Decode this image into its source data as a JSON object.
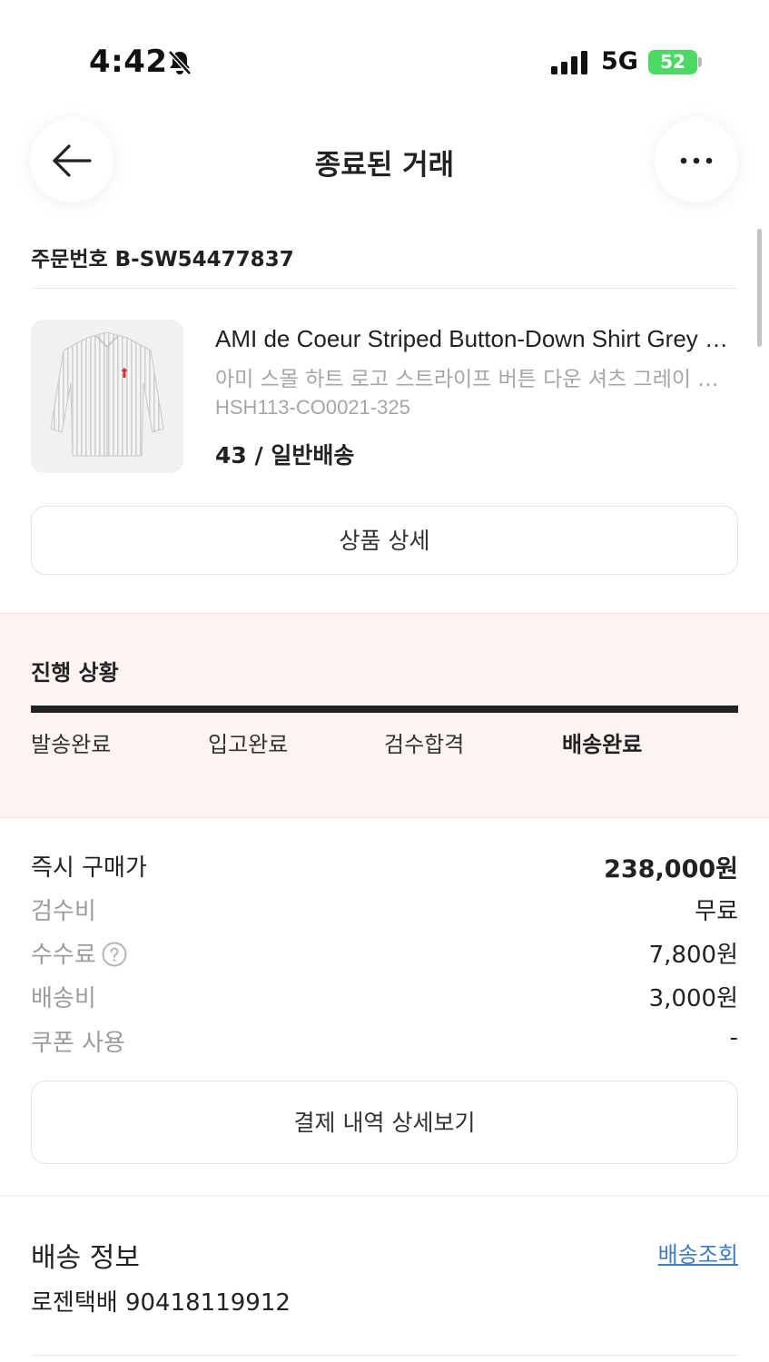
{
  "status_bar": {
    "time": "4:42",
    "network": "5G",
    "battery": "52",
    "icons": [
      "bell-slash-icon",
      "signal-icon",
      "battery-charging-icon"
    ],
    "battery_color": "#4cd964"
  },
  "header": {
    "title": "종료된 거래",
    "back_icon": "arrow-left-icon",
    "more_icon": "more-horizontal-icon"
  },
  "order": {
    "label": "주문번호",
    "number": "B-SW54477837"
  },
  "product": {
    "name": "AMI de Coeur Striped Button-Down Shirt Grey White",
    "subtitle": "아미 스몰 하트 로고 스트라이프 버튼 다운 셔츠 그레이 화이트",
    "code": "HSH113-CO0021-325",
    "option": "43 / 일반배송",
    "detail_button": "상품 상세"
  },
  "progress": {
    "title": "진행 상황",
    "steps": [
      "발송완료",
      "입고완료",
      "검수합격",
      "배송완료"
    ],
    "active_step": 3,
    "background": "#fdf3f3"
  },
  "pricing": {
    "rows": [
      {
        "label": "즉시 구매가",
        "value": "238,000원"
      },
      {
        "label": "검수비",
        "value": "무료"
      },
      {
        "label": "수수료",
        "value": "7,800원"
      },
      {
        "label": "배송비",
        "value": "3,000원"
      },
      {
        "label": "쿠폰 사용",
        "value": "-"
      }
    ],
    "help_icon": "question-circle-icon",
    "receipt_button": "결제 내역 상세보기"
  },
  "shipping": {
    "title": "배송 정보",
    "track_link": "배송조회",
    "carrier_info": "로젠택배 90418119912",
    "link_color": "#3e7cc4"
  }
}
